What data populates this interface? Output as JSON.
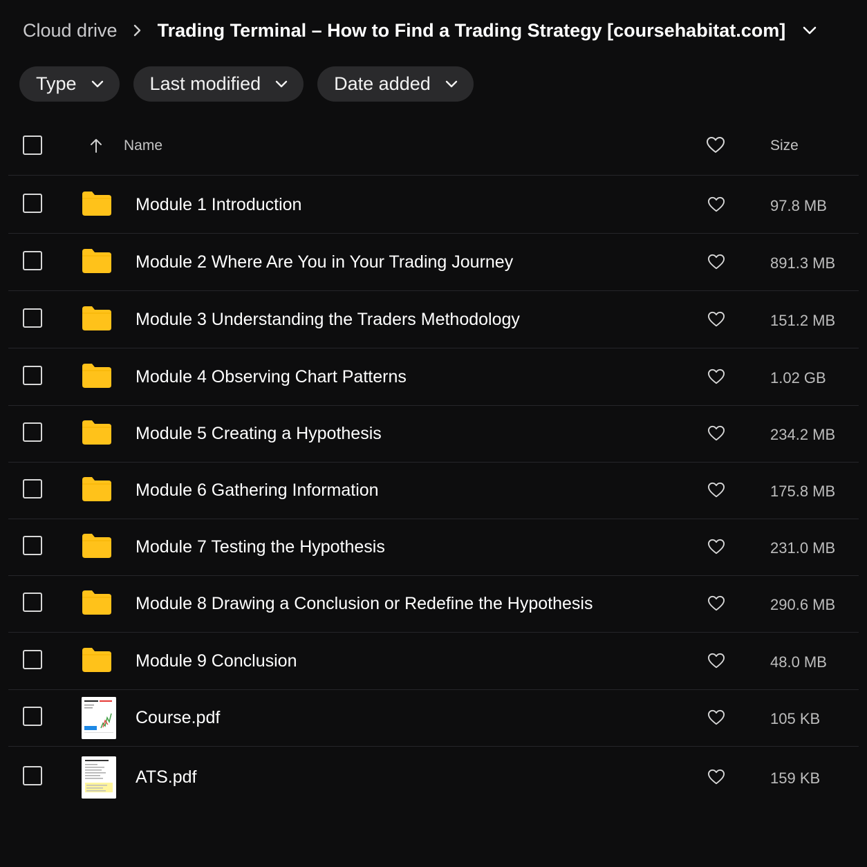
{
  "breadcrumb": {
    "root": "Cloud drive",
    "current": "Trading Terminal – How to Find a Trading Strategy [coursehabitat.com]"
  },
  "filters": {
    "type_label": "Type",
    "last_modified_label": "Last modified",
    "date_added_label": "Date added"
  },
  "table": {
    "name_header": "Name",
    "size_header": "Size",
    "rows": [
      {
        "name": "Module 1 Introduction",
        "size": "97.8 MB",
        "kind": "folder"
      },
      {
        "name": "Module 2 Where Are You in Your Trading Journey",
        "size": "891.3 MB",
        "kind": "folder"
      },
      {
        "name": "Module 3 Understanding the Traders Methodology",
        "size": "151.2 MB",
        "kind": "folder"
      },
      {
        "name": "Module 4 Observing Chart Patterns",
        "size": "1.02 GB",
        "kind": "folder"
      },
      {
        "name": "Module 5 Creating a Hypothesis",
        "size": "234.2 MB",
        "kind": "folder"
      },
      {
        "name": "Module 6 Gathering Information",
        "size": "175.8 MB",
        "kind": "folder"
      },
      {
        "name": "Module 7 Testing the Hypothesis",
        "size": "231.0 MB",
        "kind": "folder"
      },
      {
        "name": "Module 8 Drawing a Conclusion or Redefine the Hypothesis",
        "size": "290.6 MB",
        "kind": "folder"
      },
      {
        "name": "Module 9 Conclusion",
        "size": "48.0 MB",
        "kind": "folder"
      },
      {
        "name": "Course.pdf",
        "size": "105 KB",
        "kind": "pdf"
      },
      {
        "name": "ATS.pdf",
        "size": "159 KB",
        "kind": "pdf"
      }
    ]
  },
  "colors": {
    "background": "#0d0d0e",
    "pill": "#2a2a2c",
    "folder": "#ffc21a",
    "divider": "#26262a"
  },
  "icons": {
    "folder": "folder-icon",
    "heart": "heart-icon",
    "sort": "arrow-up-icon",
    "chevron": "chevron-down-icon",
    "separator": "chevron-right-icon"
  }
}
